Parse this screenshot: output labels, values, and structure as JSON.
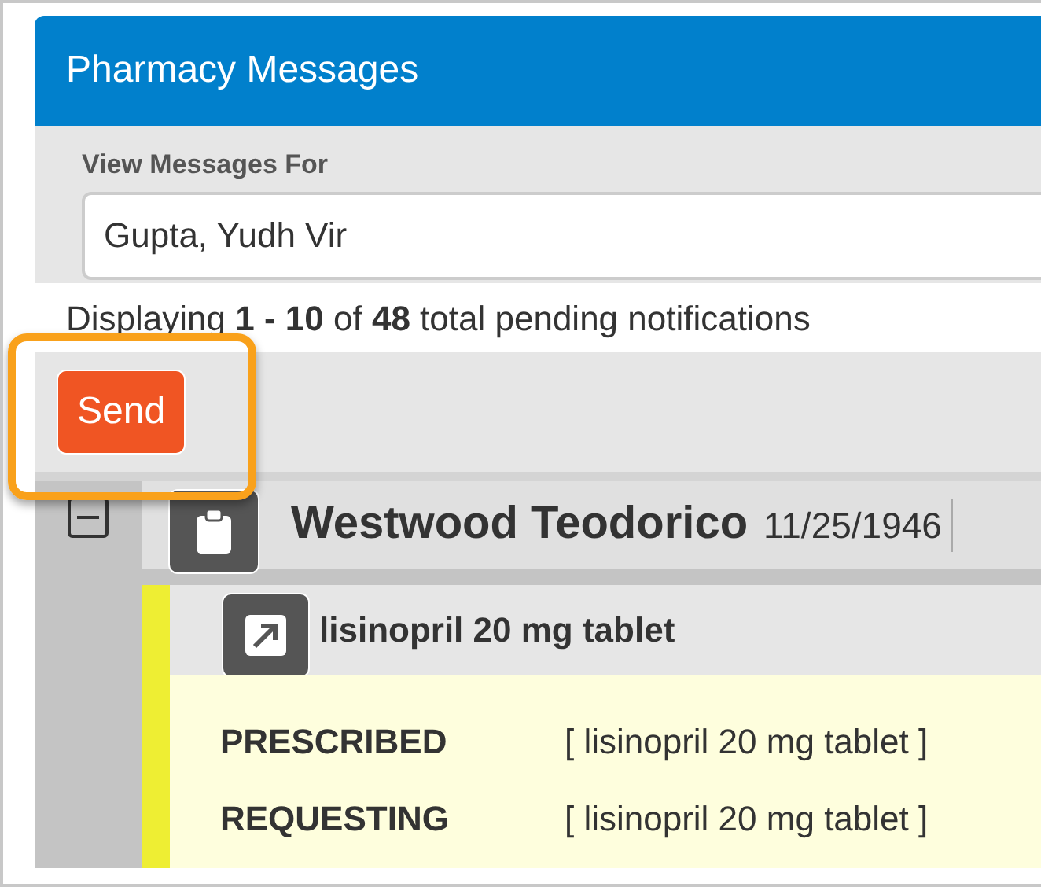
{
  "window": {
    "title": "Pharmacy Messages"
  },
  "filter": {
    "label": "View Messages For",
    "value": "Gupta, Yudh Vir"
  },
  "summary": "Displaying **1 - 10** of **48** total pending notifications",
  "toolbar": {
    "send_button": {
      "label": "Send",
      "highlighted": true
    }
  },
  "patients": [
    {
      "name": "Westwood Teodorico",
      "dob": "11/25/1946",
      "expanded": true,
      "medications": [
        {
          "name": "lisinopril 20 mg tablet",
          "color": "#eeee33",
          "details": [
            {
              "label": "PRESCRIBED",
              "value": "[ lisinopril 20 mg tablet ]"
            },
            {
              "label": "REQUESTING",
              "value": "[ lisinopril 20 mg tablet ]"
            }
          ]
        }
      ]
    }
  ]
}
